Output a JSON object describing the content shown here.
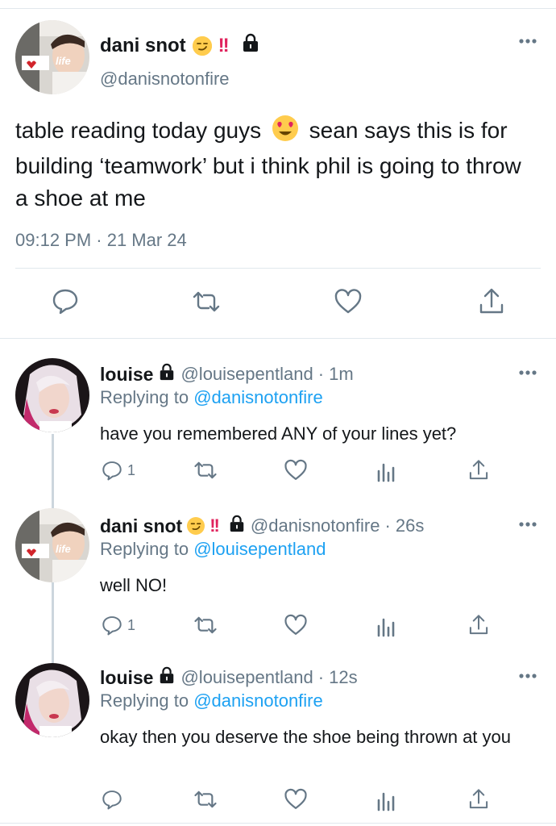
{
  "main_tweet": {
    "author": {
      "name": "dani snot",
      "emoji_1": "😏",
      "emoji_2": "‼️",
      "handle": "@danisnotonfire",
      "avatar_text": "life"
    },
    "text_part1": "table reading today guys",
    "text_emoji": "😍",
    "text_part2": "sean says this is for building ‘teamwork’ but i think phil is going to throw a shoe at me",
    "timestamp": "09:12 PM · 21 Mar 24",
    "actions": [
      "reply-icon",
      "retweet-icon",
      "like-icon",
      "share-icon"
    ]
  },
  "replies": [
    {
      "name": "louise",
      "handle": "@louisepentland",
      "time": "· 1m",
      "replying_label": "Replying to",
      "replying_to": "@danisnotonfire",
      "text": "have you remembered ANY of your lines yet?",
      "reply_count": "1"
    },
    {
      "name": "dani snot",
      "emoji_1": "😏",
      "emoji_2": "‼️",
      "handle": "@danisnotonfire",
      "time": "· 26s",
      "replying_label": "Replying to",
      "replying_to": "@louisepentland",
      "text": "well NO!",
      "reply_count": "1",
      "avatar_text": "life"
    },
    {
      "name": "louise",
      "handle": "@louisepentland",
      "time": "· 12s",
      "replying_label": "Replying to",
      "replying_to": "@danisnotonfire",
      "text": "okay then you deserve the shoe being thrown at you",
      "reply_count": ""
    }
  ],
  "colors": {
    "link": "#1da1f2",
    "secondary_text": "#657786",
    "divider": "#e1e8ed",
    "thread_line": "#ccd6dd"
  }
}
